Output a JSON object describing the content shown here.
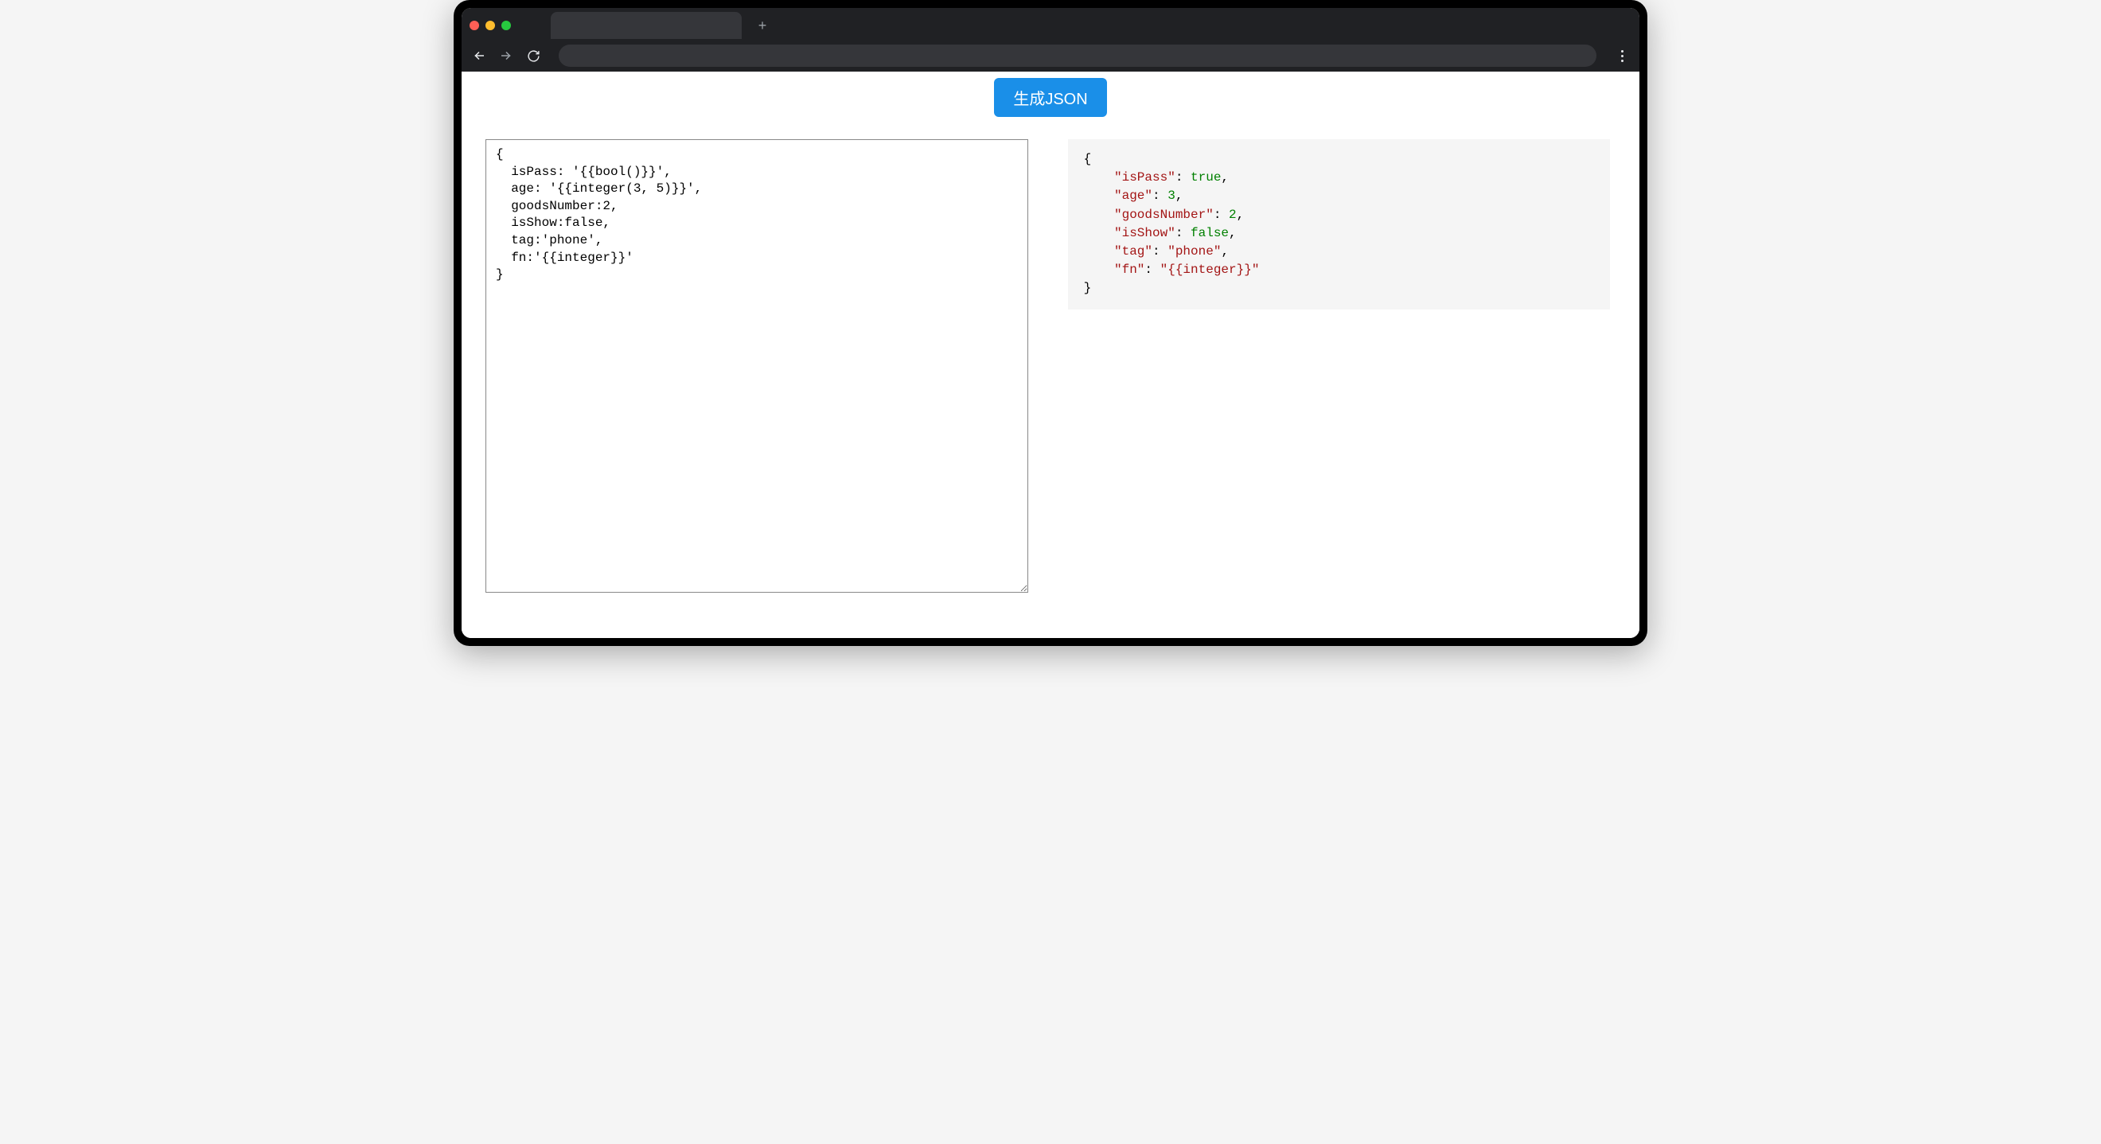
{
  "browser": {
    "tab_title": "",
    "new_tab_icon": "+"
  },
  "header": {
    "button_label": "生成JSON"
  },
  "input": {
    "text": "{\n  isPass: '{{bool()}}',\n  age: '{{integer(3, 5)}}',\n  goodsNumber:2,\n  isShow:false,\n  tag:'phone',\n  fn:'{{integer}}'\n}"
  },
  "output": {
    "tokens": [
      {
        "t": "punc",
        "v": "{"
      },
      {
        "t": "nl"
      },
      {
        "t": "indent"
      },
      {
        "t": "key",
        "v": "\"isPass\""
      },
      {
        "t": "punc",
        "v": ": "
      },
      {
        "t": "bool",
        "v": "true"
      },
      {
        "t": "punc",
        "v": ","
      },
      {
        "t": "nl"
      },
      {
        "t": "indent"
      },
      {
        "t": "key",
        "v": "\"age\""
      },
      {
        "t": "punc",
        "v": ": "
      },
      {
        "t": "num",
        "v": "3"
      },
      {
        "t": "punc",
        "v": ","
      },
      {
        "t": "nl"
      },
      {
        "t": "indent"
      },
      {
        "t": "key",
        "v": "\"goodsNumber\""
      },
      {
        "t": "punc",
        "v": ": "
      },
      {
        "t": "num",
        "v": "2"
      },
      {
        "t": "punc",
        "v": ","
      },
      {
        "t": "nl"
      },
      {
        "t": "indent"
      },
      {
        "t": "key",
        "v": "\"isShow\""
      },
      {
        "t": "punc",
        "v": ": "
      },
      {
        "t": "bool",
        "v": "false"
      },
      {
        "t": "punc",
        "v": ","
      },
      {
        "t": "nl"
      },
      {
        "t": "indent"
      },
      {
        "t": "key",
        "v": "\"tag\""
      },
      {
        "t": "punc",
        "v": ": "
      },
      {
        "t": "str",
        "v": "\"phone\""
      },
      {
        "t": "punc",
        "v": ","
      },
      {
        "t": "nl"
      },
      {
        "t": "indent"
      },
      {
        "t": "key",
        "v": "\"fn\""
      },
      {
        "t": "punc",
        "v": ": "
      },
      {
        "t": "str",
        "v": "\"{{integer}}\""
      },
      {
        "t": "nl"
      },
      {
        "t": "punc",
        "v": "}"
      }
    ]
  }
}
